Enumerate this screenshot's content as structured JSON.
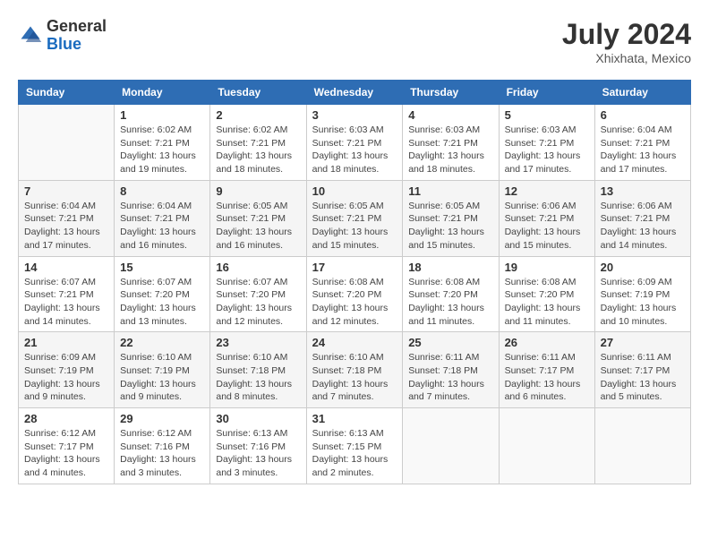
{
  "header": {
    "logo_general": "General",
    "logo_blue": "Blue",
    "title": "July 2024",
    "location": "Xhixhata, Mexico"
  },
  "columns": [
    "Sunday",
    "Monday",
    "Tuesday",
    "Wednesday",
    "Thursday",
    "Friday",
    "Saturday"
  ],
  "weeks": [
    [
      {
        "day": "",
        "sunrise": "",
        "sunset": "",
        "daylight": ""
      },
      {
        "day": "1",
        "sunrise": "Sunrise: 6:02 AM",
        "sunset": "Sunset: 7:21 PM",
        "daylight": "Daylight: 13 hours and 19 minutes."
      },
      {
        "day": "2",
        "sunrise": "Sunrise: 6:02 AM",
        "sunset": "Sunset: 7:21 PM",
        "daylight": "Daylight: 13 hours and 18 minutes."
      },
      {
        "day": "3",
        "sunrise": "Sunrise: 6:03 AM",
        "sunset": "Sunset: 7:21 PM",
        "daylight": "Daylight: 13 hours and 18 minutes."
      },
      {
        "day": "4",
        "sunrise": "Sunrise: 6:03 AM",
        "sunset": "Sunset: 7:21 PM",
        "daylight": "Daylight: 13 hours and 18 minutes."
      },
      {
        "day": "5",
        "sunrise": "Sunrise: 6:03 AM",
        "sunset": "Sunset: 7:21 PM",
        "daylight": "Daylight: 13 hours and 17 minutes."
      },
      {
        "day": "6",
        "sunrise": "Sunrise: 6:04 AM",
        "sunset": "Sunset: 7:21 PM",
        "daylight": "Daylight: 13 hours and 17 minutes."
      }
    ],
    [
      {
        "day": "7",
        "sunrise": "Sunrise: 6:04 AM",
        "sunset": "Sunset: 7:21 PM",
        "daylight": "Daylight: 13 hours and 17 minutes."
      },
      {
        "day": "8",
        "sunrise": "Sunrise: 6:04 AM",
        "sunset": "Sunset: 7:21 PM",
        "daylight": "Daylight: 13 hours and 16 minutes."
      },
      {
        "day": "9",
        "sunrise": "Sunrise: 6:05 AM",
        "sunset": "Sunset: 7:21 PM",
        "daylight": "Daylight: 13 hours and 16 minutes."
      },
      {
        "day": "10",
        "sunrise": "Sunrise: 6:05 AM",
        "sunset": "Sunset: 7:21 PM",
        "daylight": "Daylight: 13 hours and 15 minutes."
      },
      {
        "day": "11",
        "sunrise": "Sunrise: 6:05 AM",
        "sunset": "Sunset: 7:21 PM",
        "daylight": "Daylight: 13 hours and 15 minutes."
      },
      {
        "day": "12",
        "sunrise": "Sunrise: 6:06 AM",
        "sunset": "Sunset: 7:21 PM",
        "daylight": "Daylight: 13 hours and 15 minutes."
      },
      {
        "day": "13",
        "sunrise": "Sunrise: 6:06 AM",
        "sunset": "Sunset: 7:21 PM",
        "daylight": "Daylight: 13 hours and 14 minutes."
      }
    ],
    [
      {
        "day": "14",
        "sunrise": "Sunrise: 6:07 AM",
        "sunset": "Sunset: 7:21 PM",
        "daylight": "Daylight: 13 hours and 14 minutes."
      },
      {
        "day": "15",
        "sunrise": "Sunrise: 6:07 AM",
        "sunset": "Sunset: 7:20 PM",
        "daylight": "Daylight: 13 hours and 13 minutes."
      },
      {
        "day": "16",
        "sunrise": "Sunrise: 6:07 AM",
        "sunset": "Sunset: 7:20 PM",
        "daylight": "Daylight: 13 hours and 12 minutes."
      },
      {
        "day": "17",
        "sunrise": "Sunrise: 6:08 AM",
        "sunset": "Sunset: 7:20 PM",
        "daylight": "Daylight: 13 hours and 12 minutes."
      },
      {
        "day": "18",
        "sunrise": "Sunrise: 6:08 AM",
        "sunset": "Sunset: 7:20 PM",
        "daylight": "Daylight: 13 hours and 11 minutes."
      },
      {
        "day": "19",
        "sunrise": "Sunrise: 6:08 AM",
        "sunset": "Sunset: 7:20 PM",
        "daylight": "Daylight: 13 hours and 11 minutes."
      },
      {
        "day": "20",
        "sunrise": "Sunrise: 6:09 AM",
        "sunset": "Sunset: 7:19 PM",
        "daylight": "Daylight: 13 hours and 10 minutes."
      }
    ],
    [
      {
        "day": "21",
        "sunrise": "Sunrise: 6:09 AM",
        "sunset": "Sunset: 7:19 PM",
        "daylight": "Daylight: 13 hours and 9 minutes."
      },
      {
        "day": "22",
        "sunrise": "Sunrise: 6:10 AM",
        "sunset": "Sunset: 7:19 PM",
        "daylight": "Daylight: 13 hours and 9 minutes."
      },
      {
        "day": "23",
        "sunrise": "Sunrise: 6:10 AM",
        "sunset": "Sunset: 7:18 PM",
        "daylight": "Daylight: 13 hours and 8 minutes."
      },
      {
        "day": "24",
        "sunrise": "Sunrise: 6:10 AM",
        "sunset": "Sunset: 7:18 PM",
        "daylight": "Daylight: 13 hours and 7 minutes."
      },
      {
        "day": "25",
        "sunrise": "Sunrise: 6:11 AM",
        "sunset": "Sunset: 7:18 PM",
        "daylight": "Daylight: 13 hours and 7 minutes."
      },
      {
        "day": "26",
        "sunrise": "Sunrise: 6:11 AM",
        "sunset": "Sunset: 7:17 PM",
        "daylight": "Daylight: 13 hours and 6 minutes."
      },
      {
        "day": "27",
        "sunrise": "Sunrise: 6:11 AM",
        "sunset": "Sunset: 7:17 PM",
        "daylight": "Daylight: 13 hours and 5 minutes."
      }
    ],
    [
      {
        "day": "28",
        "sunrise": "Sunrise: 6:12 AM",
        "sunset": "Sunset: 7:17 PM",
        "daylight": "Daylight: 13 hours and 4 minutes."
      },
      {
        "day": "29",
        "sunrise": "Sunrise: 6:12 AM",
        "sunset": "Sunset: 7:16 PM",
        "daylight": "Daylight: 13 hours and 3 minutes."
      },
      {
        "day": "30",
        "sunrise": "Sunrise: 6:13 AM",
        "sunset": "Sunset: 7:16 PM",
        "daylight": "Daylight: 13 hours and 3 minutes."
      },
      {
        "day": "31",
        "sunrise": "Sunrise: 6:13 AM",
        "sunset": "Sunset: 7:15 PM",
        "daylight": "Daylight: 13 hours and 2 minutes."
      },
      {
        "day": "",
        "sunrise": "",
        "sunset": "",
        "daylight": ""
      },
      {
        "day": "",
        "sunrise": "",
        "sunset": "",
        "daylight": ""
      },
      {
        "day": "",
        "sunrise": "",
        "sunset": "",
        "daylight": ""
      }
    ]
  ]
}
